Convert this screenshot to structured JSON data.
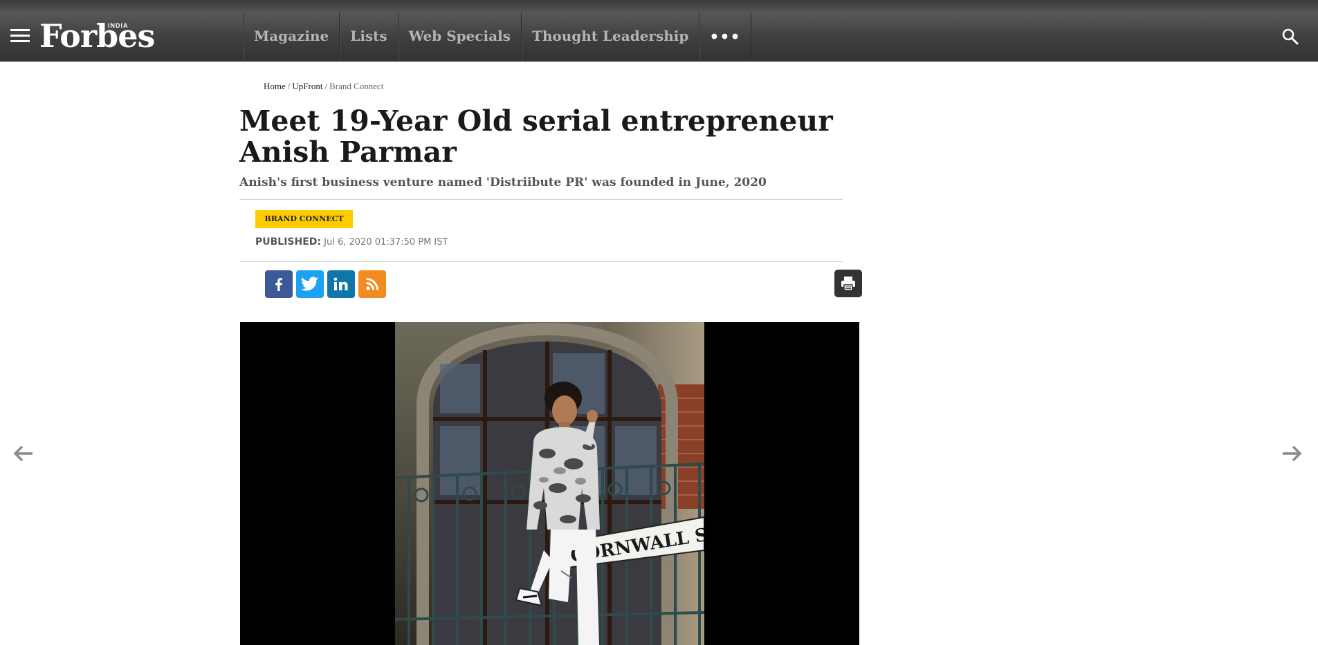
{
  "header": {
    "logo_text": "Forbes",
    "logo_edition": "INDIA",
    "nav_items": [
      {
        "label": "Magazine"
      },
      {
        "label": "Lists"
      },
      {
        "label": "Web Specials"
      },
      {
        "label": "Thought Leadership"
      }
    ],
    "more_label": "•••",
    "menu_icon": "hamburger-icon",
    "search_icon": "search-icon"
  },
  "breadcrumb": [
    {
      "label": "Home"
    },
    {
      "label": "UpFront"
    },
    {
      "label": "Brand Connect"
    }
  ],
  "article": {
    "title": "Meet 19-Year Old serial entrepreneur Anish Parmar",
    "subtitle": "Anish's first business venture named 'Distriibute PR' was founded in June, 2020",
    "tag": "BRAND CONNECT",
    "published_label": "PUBLISHED:",
    "published_date": "Jul 6, 2020 01:37:50 PM IST"
  },
  "share": {
    "buttons": [
      {
        "icon": "facebook-icon",
        "color": "#3b5998"
      },
      {
        "icon": "twitter-icon",
        "color": "#1da1f2"
      },
      {
        "icon": "linkedin-icon",
        "color": "#0e76a8"
      },
      {
        "icon": "rss-icon",
        "color": "#f28b20"
      }
    ],
    "print_icon": "print-icon"
  },
  "hero": {
    "street_sign_text": "CORNWALL ST"
  },
  "colors": {
    "tag_background": "#ffcc00",
    "nav_background": "#3e3e3e",
    "nav_text": "#b4b4b4"
  }
}
